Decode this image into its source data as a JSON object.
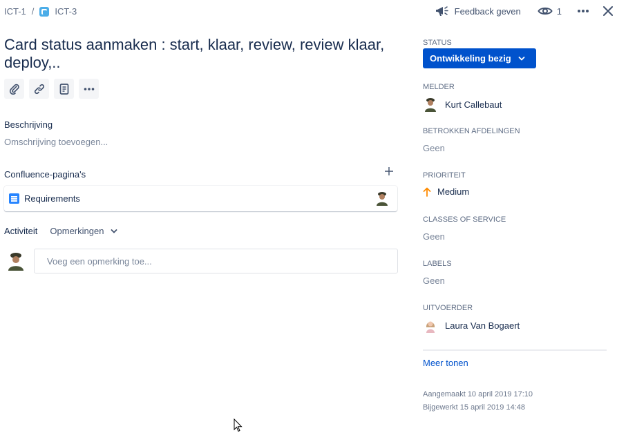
{
  "breadcrumb": {
    "parent": "ICT-1",
    "separator": "/",
    "current": "ICT-3"
  },
  "top_actions": {
    "feedback_label": "Feedback geven",
    "watch_count": "1"
  },
  "issue": {
    "title": "Card status aanmaken : start, klaar, review, review klaar, deploy,.."
  },
  "toolbar": {
    "items": [
      "attachment-icon",
      "link-icon",
      "page-icon",
      "more-icon"
    ]
  },
  "description": {
    "label": "Beschrijving",
    "placeholder": "Omschrijving toevoegen..."
  },
  "confluence": {
    "label": "Confluence-pagina's",
    "pages": [
      {
        "title": "Requirements"
      }
    ]
  },
  "activity": {
    "label": "Activiteit",
    "filter": "Opmerkingen",
    "comment_placeholder": "Voeg een opmerking toe..."
  },
  "sidebar": {
    "status_label": "STATUS",
    "status_value": "Ontwikkeling bezig",
    "reporter_label": "MELDER",
    "reporter_value": "Kurt Callebaut",
    "departments_label": "BETROKKEN AFDELINGEN",
    "departments_value": "Geen",
    "priority_label": "PRIORITEIT",
    "priority_value": "Medium",
    "cos_label": "CLASSES OF SERVICE",
    "cos_value": "Geen",
    "labels_label": "LABELS",
    "labels_value": "Geen",
    "assignee_label": "UITVOERDER",
    "assignee_value": "Laura Van Bogaert",
    "more_label": "Meer tonen",
    "created": "Aangemaakt 10 april 2019 17:10",
    "updated": "Bijgewerkt 15 april 2019 14:48"
  },
  "colors": {
    "primary": "#0052cc",
    "text": "#172b4d",
    "muted": "#7a869a",
    "priority_medium": "#ff8b00"
  }
}
